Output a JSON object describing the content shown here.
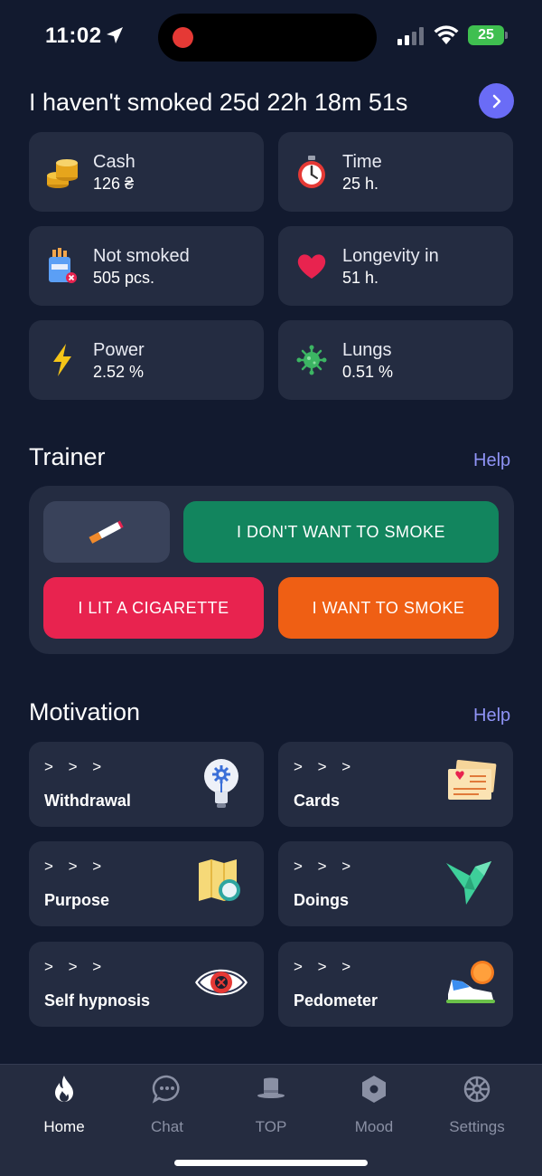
{
  "status": {
    "time": "11:02",
    "battery": "25"
  },
  "header": {
    "headline": "I haven't smoked 25d 22h 18m 51s"
  },
  "stats": [
    {
      "label": "Cash",
      "value": "126 ₴",
      "icon": "coins-icon"
    },
    {
      "label": "Time",
      "value": "25 h.",
      "icon": "stopwatch-icon"
    },
    {
      "label": "Not smoked",
      "value": "505 pcs.",
      "icon": "cigarette-pack-icon"
    },
    {
      "label": "Longevity in",
      "value": "51 h.",
      "icon": "heart-icon"
    },
    {
      "label": "Power",
      "value": "2.52 %",
      "icon": "lightning-icon"
    },
    {
      "label": "Lungs",
      "value": "0.51 %",
      "icon": "virus-icon"
    }
  ],
  "trainer": {
    "title": "Trainer",
    "help": "Help",
    "dont_want": "I DON'T WANT TO SMOKE",
    "lit": "I LIT A CIGARETTE",
    "want": "I WANT TO SMOKE"
  },
  "motivation": {
    "title": "Motivation",
    "help": "Help",
    "arrows": "> > >",
    "items": [
      {
        "label": "Withdrawal",
        "icon": "lightbulb-icon"
      },
      {
        "label": "Cards",
        "icon": "postcards-icon"
      },
      {
        "label": "Purpose",
        "icon": "map-icon"
      },
      {
        "label": "Doings",
        "icon": "origami-bird-icon"
      },
      {
        "label": "Self hypnosis",
        "icon": "hypnosis-eye-icon"
      },
      {
        "label": "Pedometer",
        "icon": "sneaker-icon"
      }
    ]
  },
  "tabs": [
    {
      "label": "Home",
      "icon": "flame-icon",
      "active": true
    },
    {
      "label": "Chat",
      "icon": "chat-bubble-icon",
      "active": false
    },
    {
      "label": "TOP",
      "icon": "top-hat-icon",
      "active": false
    },
    {
      "label": "Mood",
      "icon": "hexagon-icon",
      "active": false
    },
    {
      "label": "Settings",
      "icon": "gear-icon",
      "active": false
    }
  ],
  "colors": {
    "background": "#121a2f",
    "card": "#242c41",
    "accent": "#6a6cf6",
    "green": "#12855e",
    "red": "#e8234f",
    "orange": "#ef5f14"
  }
}
